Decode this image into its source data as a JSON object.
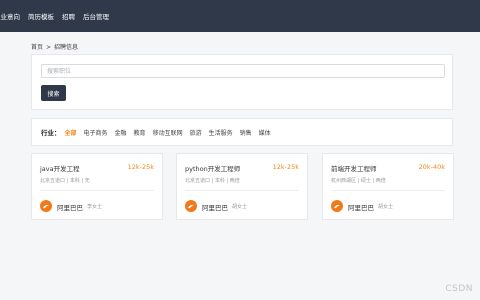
{
  "navbar": {
    "items": [
      "职业意向",
      "简历模板",
      "招聘",
      "后台管理"
    ]
  },
  "breadcrumb": {
    "home": "首页",
    "separator": ">",
    "current": "招聘信息"
  },
  "search": {
    "placeholder": "搜索职位",
    "value": "",
    "button_label": "搜索"
  },
  "filter": {
    "label": "行业：",
    "items": [
      "全部",
      "电子商务",
      "金融",
      "教育",
      "移动互联网",
      "旅游",
      "生活服务",
      "销售",
      "媒体"
    ],
    "active": "全部"
  },
  "jobs": [
    {
      "title": "java开发工程",
      "salary": "12k-25k",
      "meta": "北京五道口 | 本科 | 无",
      "company": "阿里巴巴",
      "contact": "李女士"
    },
    {
      "title": "python开发工程师",
      "salary": "12k-25k",
      "meta": "北京五道口 | 本科 | 两倍",
      "company": "阿里巴巴",
      "contact": "胡女士"
    },
    {
      "title": "前端开发工程师",
      "salary": "20k-40k",
      "meta": "杭州西湖区 | 硕士 | 两倍",
      "company": "阿里巴巴",
      "contact": "胡女士"
    }
  ],
  "watermark": "CSDN",
  "colors": {
    "nav_bg": "#30394a",
    "accent": "#f08a1c",
    "logo": "#f07a1a"
  },
  "icons": {
    "company_logo": "alibaba-logo-icon"
  }
}
